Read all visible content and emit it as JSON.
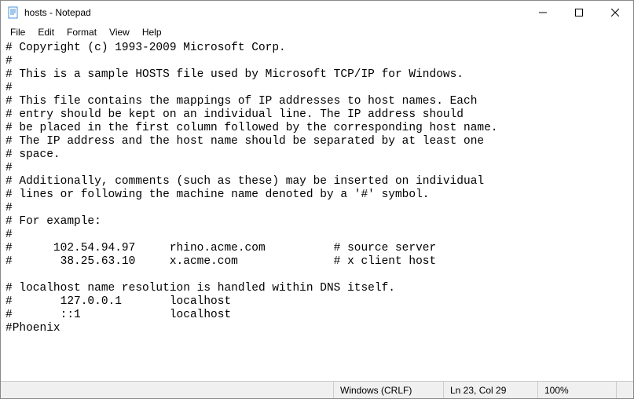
{
  "titlebar": {
    "title": "hosts - Notepad"
  },
  "menubar": {
    "items": [
      "File",
      "Edit",
      "Format",
      "View",
      "Help"
    ]
  },
  "editor": {
    "content": "# Copyright (c) 1993-2009 Microsoft Corp.\n#\n# This is a sample HOSTS file used by Microsoft TCP/IP for Windows.\n#\n# This file contains the mappings of IP addresses to host names. Each\n# entry should be kept on an individual line. The IP address should\n# be placed in the first column followed by the corresponding host name.\n# The IP address and the host name should be separated by at least one\n# space.\n#\n# Additionally, comments (such as these) may be inserted on individual\n# lines or following the machine name denoted by a '#' symbol.\n#\n# For example:\n#\n#      102.54.94.97     rhino.acme.com          # source server\n#       38.25.63.10     x.acme.com              # x client host\n\n# localhost name resolution is handled within DNS itself.\n#       127.0.0.1       localhost\n#       ::1             localhost\n#Phoenix"
  },
  "statusbar": {
    "line_ending": "Windows (CRLF)",
    "position": "Ln 23, Col 29",
    "zoom": "100%"
  }
}
